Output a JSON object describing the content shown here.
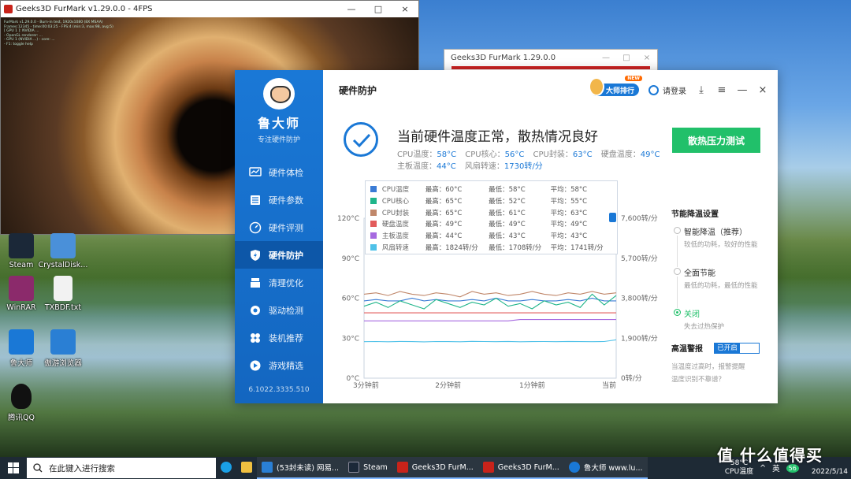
{
  "furmark_main": {
    "title": "Geeks3D FurMark v1.29.0.0 - 4FPS",
    "controls": [
      "—",
      "□",
      "×"
    ],
    "overlay": [
      "FurMark v1.29.0.0 - Burn-in test, 1920x1080 (8X MSAA)",
      "Frames:12345 - time:00:03:25 - FPS:4 (min:3, max:98, avg:5)",
      "[ GPU 1 ]: NVIDIA ...",
      "- OpenGL renderer: ...",
      "- GPU 1 (NVIDIA ...) - core: ...",
      "- F1: toggle help"
    ]
  },
  "furmark_second": {
    "title": "Geeks3D FurMark 1.29.0.0",
    "controls": [
      "—",
      "□",
      "×"
    ]
  },
  "desktop_icons": [
    {
      "label": "Steam",
      "color": "#1b2838"
    },
    {
      "label": "CrystalDisk...",
      "color": "#4a90d9"
    },
    {
      "label": "WinRAR",
      "color": "#8b2a6b"
    },
    {
      "label": "TXBDF.txt",
      "color": "#f2f2f2"
    },
    {
      "label": "鲁大师",
      "color": "#1a78d6"
    },
    {
      "label": "傲游浏览器",
      "color": "#2a7fd4"
    },
    {
      "label": "腾讯QQ",
      "color": "#111111"
    }
  ],
  "ludashi": {
    "brand": "鲁大师",
    "tagline": "专注硬件防护",
    "version": "6.1022.3335.510",
    "nav": [
      "硬件体检",
      "硬件参数",
      "硬件评测",
      "硬件防护",
      "清理优化",
      "驱动检测",
      "装机推荐",
      "游戏精选"
    ],
    "active_nav_index": 3,
    "page_title": "硬件防护",
    "header": {
      "rank_badge": "大师排行",
      "new_tag": "NEW",
      "login": "请登录",
      "controls": [
        "⤓",
        "≡",
        "—",
        "×"
      ]
    },
    "status_message": "当前硬件温度正常，散热情况良好",
    "temps_line1": [
      {
        "label": "CPU温度：",
        "value": "58°C"
      },
      {
        "label": "CPU核心：",
        "value": "56°C"
      },
      {
        "label": "CPU封装：",
        "value": "63°C"
      },
      {
        "label": "硬盘温度：",
        "value": "49°C"
      }
    ],
    "temps_line2": [
      {
        "label": "主板温度：",
        "value": "44°C"
      },
      {
        "label": "风扇转速：",
        "value": "1730转/分"
      }
    ],
    "stress_button": "散热压力测试",
    "settings_title": "节能降温设置",
    "options": [
      {
        "label": "智能降温（推荐）",
        "desc": "较低的功耗，较好的性能",
        "selected": false
      },
      {
        "label": "全面节能",
        "desc": "最低的功耗，最低的性能",
        "selected": false
      },
      {
        "label": "关闭",
        "desc": "失去过热保护",
        "selected": true
      }
    ],
    "alarm_title": "高温警报",
    "alarm_state": "已开启",
    "alarm_desc": "当温度过高时，报警提醒\n温度识别不靠谱？"
  },
  "chart_data": {
    "type": "line",
    "x_ticks": [
      "3分钟前",
      "2分钟前",
      "1分钟前",
      "当前"
    ],
    "y_left_ticks": [
      "0°C",
      "30°C",
      "60°C",
      "90°C",
      "120°C"
    ],
    "y_right_ticks": [
      "0转/分",
      "1,900转/分",
      "3,800转/分",
      "5,700转/分",
      "7,600转/分"
    ],
    "ylim_left": [
      0,
      120
    ],
    "ylim_right": [
      0,
      7600
    ],
    "legend": [
      {
        "name": "CPU温度",
        "max": "最高：60°C",
        "min": "最低：58°C",
        "avg": "平均：58°C",
        "color": "#3a7bd5"
      },
      {
        "name": "CPU核心",
        "max": "最高：65°C",
        "min": "最低：52°C",
        "avg": "平均：55°C",
        "color": "#1fb58a"
      },
      {
        "name": "CPU封装",
        "max": "最高：65°C",
        "min": "最低：61°C",
        "avg": "平均：63°C",
        "color": "#c0876a"
      },
      {
        "name": "硬盘温度",
        "max": "最高：49°C",
        "min": "最低：49°C",
        "avg": "平均：49°C",
        "color": "#e25b5b"
      },
      {
        "name": "主板温度",
        "max": "最高：44°C",
        "min": "最低：43°C",
        "avg": "平均：43°C",
        "color": "#a66ae0"
      },
      {
        "name": "风扇转速",
        "max": "最高：1824转/分",
        "min": "最低：1708转/分",
        "avg": "平均：1741转/分",
        "color": "#4fc1e8"
      }
    ],
    "series": [
      {
        "name": "CPU温度",
        "axis": "left",
        "values": [
          58,
          59,
          58,
          58,
          60,
          58,
          59,
          58,
          58,
          59,
          58,
          60,
          58,
          58,
          59,
          58,
          58,
          59,
          58,
          60,
          58,
          58
        ]
      },
      {
        "name": "CPU核心",
        "axis": "left",
        "values": [
          54,
          57,
          53,
          58,
          55,
          52,
          59,
          56,
          53,
          57,
          55,
          60,
          54,
          56,
          52,
          58,
          55,
          57,
          53,
          63,
          55,
          62
        ]
      },
      {
        "name": "CPU封装",
        "axis": "left",
        "values": [
          63,
          64,
          62,
          65,
          63,
          62,
          64,
          63,
          61,
          65,
          63,
          64,
          62,
          63,
          65,
          63,
          62,
          64,
          63,
          65,
          63,
          64
        ]
      },
      {
        "name": "硬盘温度",
        "axis": "left",
        "values": [
          49,
          49,
          49,
          49,
          49,
          49,
          49,
          49,
          49,
          49,
          49,
          49,
          49,
          49,
          49,
          49,
          49,
          49,
          49,
          49,
          49,
          49
        ]
      },
      {
        "name": "主板温度",
        "axis": "left",
        "values": [
          43,
          43,
          43,
          43,
          43,
          43,
          43,
          43,
          43,
          43,
          43,
          43,
          43,
          44,
          44,
          44,
          44,
          44,
          44,
          44,
          44,
          44
        ]
      },
      {
        "name": "风扇转速",
        "axis": "right",
        "values": [
          1735,
          1740,
          1730,
          1745,
          1738,
          1725,
          1742,
          1736,
          1731,
          1748,
          1740,
          1735,
          1744,
          1730,
          1739,
          1741,
          1734,
          1746,
          1738,
          1733,
          1742,
          1824
        ]
      }
    ]
  },
  "taskbar": {
    "search_placeholder": "在此键入进行搜索",
    "apps": [
      {
        "label": "",
        "color": "#1aa0e6",
        "open": false
      },
      {
        "label": "",
        "color": "#f0c040",
        "open": false
      },
      {
        "label": "(53封未读) 网易...",
        "color": "#2a7fd4",
        "open": true
      },
      {
        "label": "Steam",
        "color": "#1b2838",
        "open": true
      },
      {
        "label": "Geeks3D FurM...",
        "color": "#c8231a",
        "open": true
      },
      {
        "label": "Geeks3D FurM...",
        "color": "#c8231a",
        "open": true
      },
      {
        "label": "鲁大师 www.lu...",
        "color": "#1a78d6",
        "open": true
      }
    ],
    "cpu_temp_value": "58°C",
    "cpu_temp_label": "CPU温度",
    "ime": "英",
    "badge": "56",
    "date": "2022/5/14"
  },
  "watermark": "值 什么值得买"
}
